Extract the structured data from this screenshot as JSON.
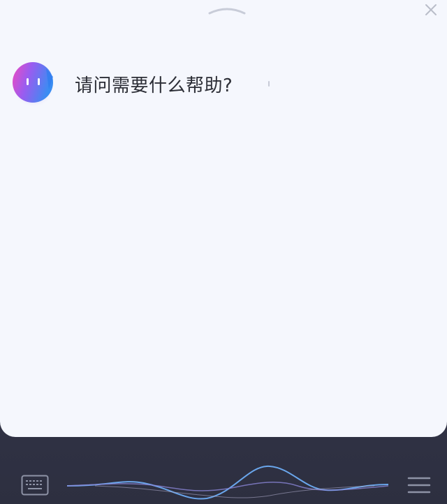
{
  "assistant": {
    "greeting": "请问需要什么帮助?"
  },
  "icons": {
    "close": "close-icon",
    "keyboard": "keyboard-icon",
    "menu": "menu-icon",
    "drag_handle": "chevron-handle-icon",
    "avatar": "assistant-avatar-icon",
    "voice_wave": "voice-wave-icon"
  },
  "colors": {
    "panel_background": "#f5f7fd",
    "bottom_bar_background": "#3a3c4c",
    "wave_primary": "#6aa6ec",
    "wave_secondary": "#8a86d6",
    "text_primary": "#2c2e36",
    "avatar_gradient_start": "#f04ac0",
    "avatar_gradient_end": "#3a8df2"
  }
}
